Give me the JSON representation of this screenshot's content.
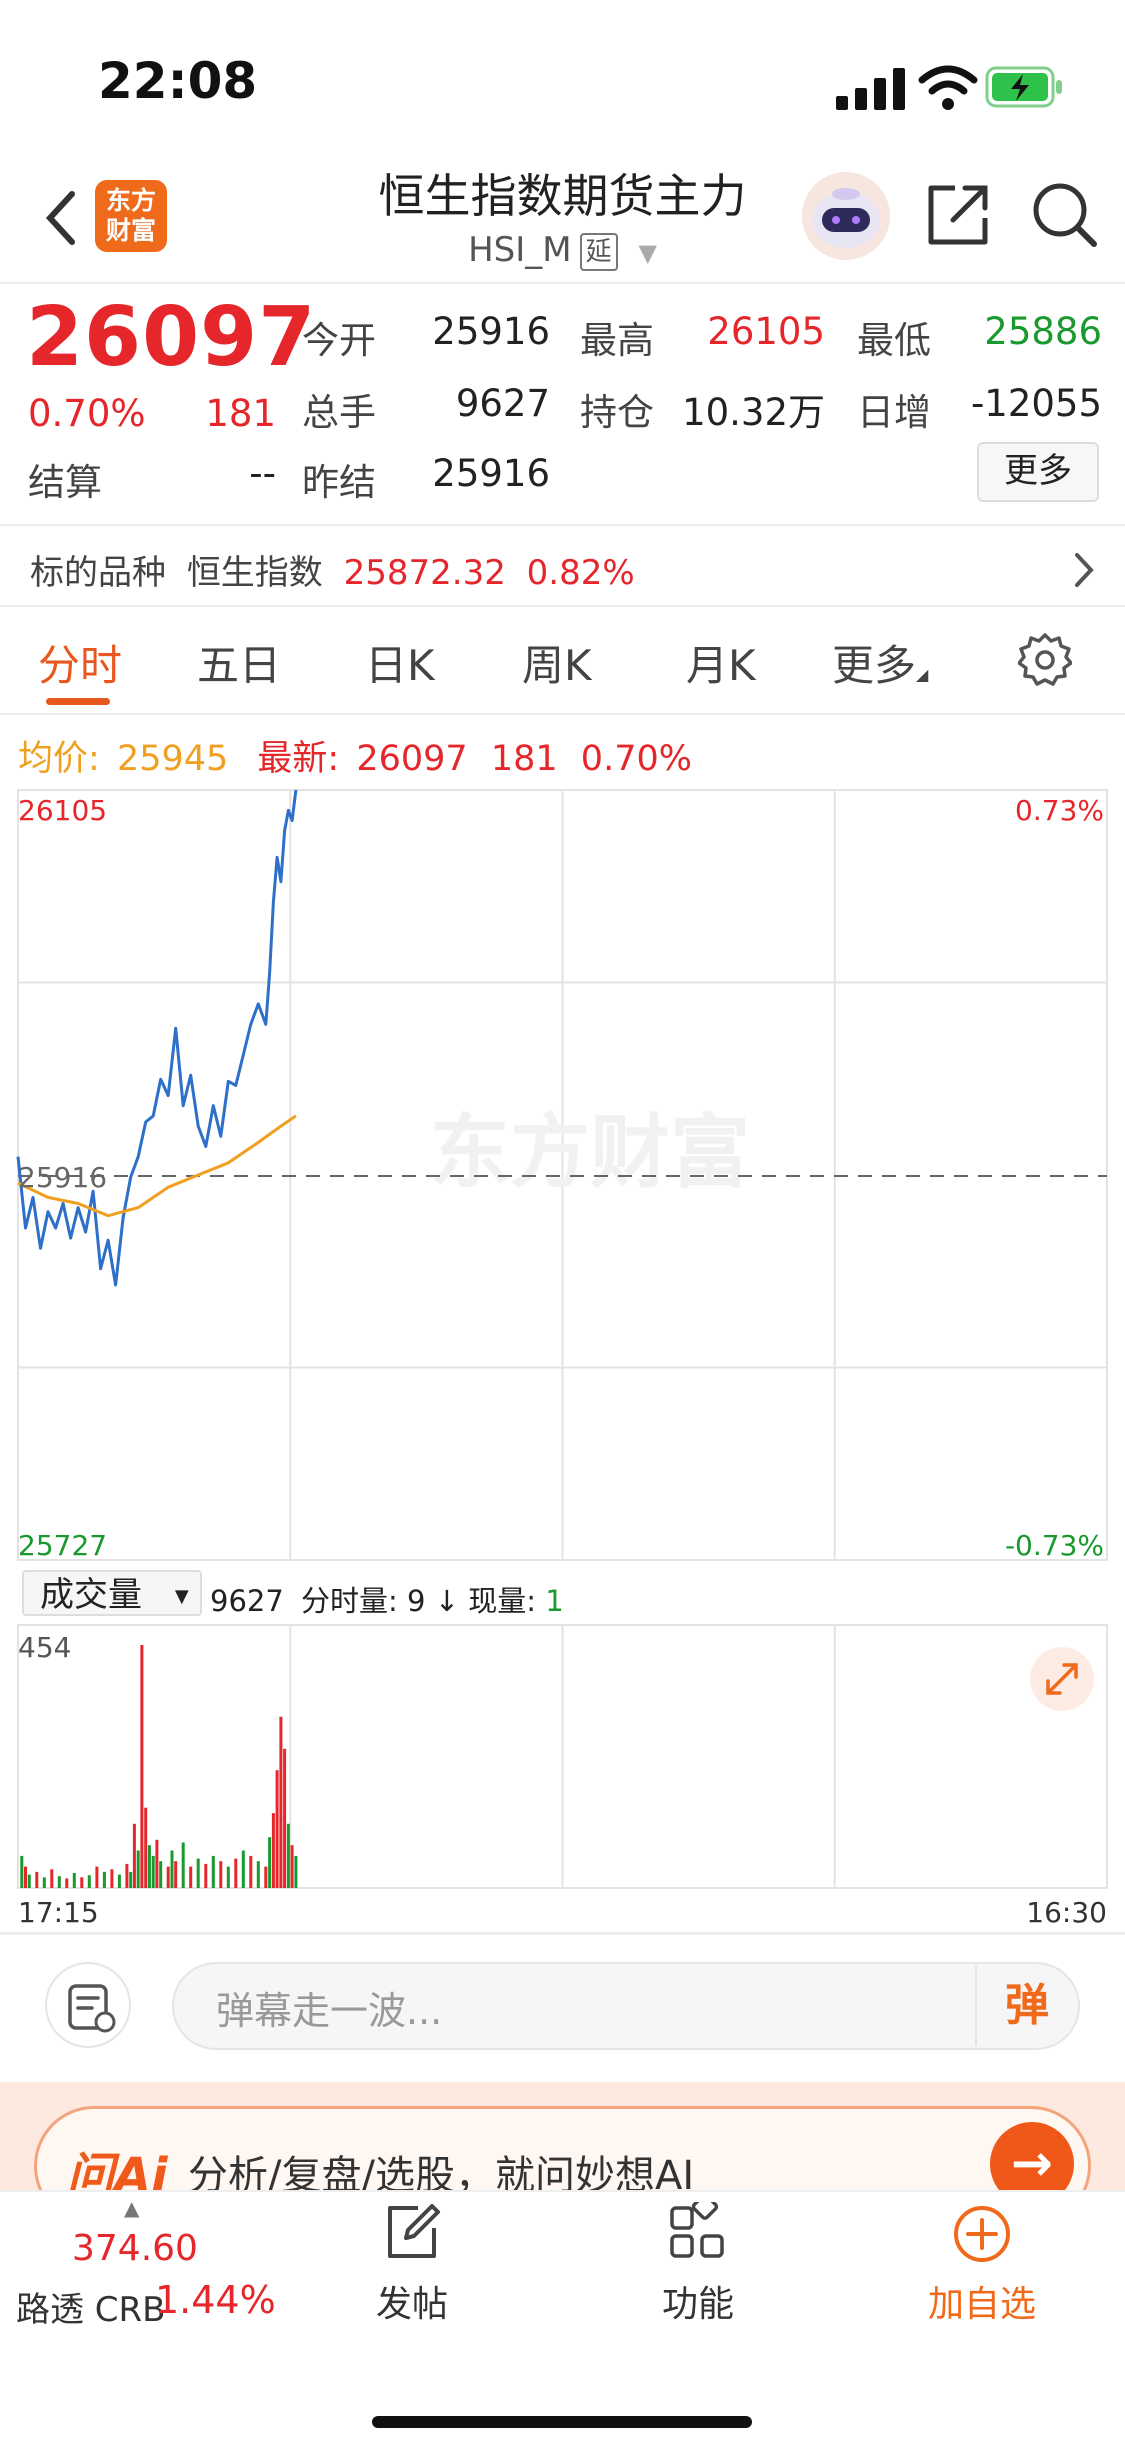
{
  "status_bar": {
    "time": "22:08"
  },
  "header": {
    "logo_text": "东方\n财富",
    "title": "恒生指数期货主力",
    "code": "HSI_M",
    "delay_tag": "延"
  },
  "quote": {
    "price": "26097",
    "change_pct": "0.70%",
    "change": "181",
    "fields": [
      {
        "label": "今开",
        "value": "25916",
        "color": "dark"
      },
      {
        "label": "最高",
        "value": "26105",
        "color": "red"
      },
      {
        "label": "最低",
        "value": "25886",
        "color": "green"
      },
      {
        "label": "总手",
        "value": "9627",
        "color": "dark"
      },
      {
        "label": "持仓",
        "value": "10.32万",
        "color": "dark"
      },
      {
        "label": "日增",
        "value": "-12055",
        "color": "dark"
      },
      {
        "label": "结算",
        "value": "--",
        "color": "dark"
      },
      {
        "label": "昨结",
        "value": "25916",
        "color": "dark"
      }
    ],
    "more_label": "更多"
  },
  "underlying": {
    "label": "标的品种",
    "name": "恒生指数",
    "price": "25872.32",
    "pct": "0.82%"
  },
  "tabs": [
    {
      "label": "分时",
      "active": true
    },
    {
      "label": "五日",
      "active": false
    },
    {
      "label": "日K",
      "active": false
    },
    {
      "label": "周K",
      "active": false
    },
    {
      "label": "月K",
      "active": false
    },
    {
      "label": "更多",
      "active": false
    }
  ],
  "info_line": {
    "avg_label": "均价:",
    "avg_value": "25945",
    "latest_label": "最新:",
    "latest_value": "26097",
    "latest_change": "181",
    "latest_pct": "0.70%"
  },
  "chart_data": {
    "type": "line",
    "y_axis_left": {
      "top": "26105",
      "mid": "25916",
      "bottom": "25727"
    },
    "y_axis_right": {
      "top": "0.73%",
      "bottom": "-0.73%"
    },
    "ylim": [
      25727,
      26105
    ],
    "reference_price": 25916,
    "x_start": "17:15",
    "x_end": "16:30",
    "watermark": "东方财富",
    "series": [
      {
        "name": "price",
        "color": "#2d6fc9",
        "x": [
          0,
          2,
          4,
          6,
          8,
          10,
          12,
          14,
          16,
          18,
          20,
          22,
          24,
          26,
          28,
          30,
          32,
          34,
          36,
          38,
          40,
          42,
          44,
          46,
          48,
          50,
          52,
          54,
          56,
          58,
          60,
          62,
          64,
          66,
          67,
          68,
          69,
          70,
          71,
          72,
          73,
          74
        ],
        "y": [
          25925,
          25890,
          25905,
          25880,
          25898,
          25890,
          25902,
          25885,
          25900,
          25888,
          25908,
          25870,
          25884,
          25862,
          25895,
          25915,
          25925,
          25942,
          25945,
          25963,
          25955,
          25988,
          25950,
          25965,
          25940,
          25930,
          25950,
          25935,
          25962,
          25960,
          25975,
          25990,
          26000,
          25990,
          26015,
          26050,
          26072,
          26060,
          26085,
          26095,
          26090,
          26105
        ]
      },
      {
        "name": "avg",
        "color": "#f0a020",
        "x": [
          0,
          8,
          16,
          24,
          32,
          40,
          48,
          56,
          64,
          70,
          74
        ],
        "y": [
          25912,
          25905,
          25902,
          25896,
          25900,
          25910,
          25916,
          25922,
          25932,
          25940,
          25945
        ]
      }
    ],
    "volume": {
      "selector_label": "成交量",
      "max_label": "454",
      "total_value": "9627",
      "minute_label": "分时量:",
      "minute_value": "9",
      "current_label": "现量:",
      "current_value": "1",
      "bars": [
        {
          "x": 1,
          "v": 60,
          "c": "green"
        },
        {
          "x": 2,
          "v": 40,
          "c": "red"
        },
        {
          "x": 3,
          "v": 25,
          "c": "green"
        },
        {
          "x": 5,
          "v": 30,
          "c": "red"
        },
        {
          "x": 7,
          "v": 20,
          "c": "green"
        },
        {
          "x": 9,
          "v": 35,
          "c": "red"
        },
        {
          "x": 11,
          "v": 22,
          "c": "green"
        },
        {
          "x": 13,
          "v": 18,
          "c": "red"
        },
        {
          "x": 15,
          "v": 28,
          "c": "green"
        },
        {
          "x": 17,
          "v": 20,
          "c": "red"
        },
        {
          "x": 19,
          "v": 24,
          "c": "green"
        },
        {
          "x": 21,
          "v": 40,
          "c": "red"
        },
        {
          "x": 23,
          "v": 30,
          "c": "green"
        },
        {
          "x": 25,
          "v": 35,
          "c": "red"
        },
        {
          "x": 27,
          "v": 25,
          "c": "green"
        },
        {
          "x": 29,
          "v": 45,
          "c": "red"
        },
        {
          "x": 30,
          "v": 30,
          "c": "green"
        },
        {
          "x": 31,
          "v": 120,
          "c": "red"
        },
        {
          "x": 32,
          "v": 70,
          "c": "green"
        },
        {
          "x": 33,
          "v": 454,
          "c": "red"
        },
        {
          "x": 34,
          "v": 150,
          "c": "red"
        },
        {
          "x": 35,
          "v": 80,
          "c": "green"
        },
        {
          "x": 36,
          "v": 60,
          "c": "green"
        },
        {
          "x": 37,
          "v": 90,
          "c": "red"
        },
        {
          "x": 38,
          "v": 50,
          "c": "green"
        },
        {
          "x": 40,
          "v": 40,
          "c": "red"
        },
        {
          "x": 41,
          "v": 70,
          "c": "green"
        },
        {
          "x": 42,
          "v": 50,
          "c": "red"
        },
        {
          "x": 44,
          "v": 85,
          "c": "green"
        },
        {
          "x": 46,
          "v": 40,
          "c": "red"
        },
        {
          "x": 48,
          "v": 55,
          "c": "green"
        },
        {
          "x": 50,
          "v": 45,
          "c": "red"
        },
        {
          "x": 52,
          "v": 60,
          "c": "green"
        },
        {
          "x": 54,
          "v": 50,
          "c": "red"
        },
        {
          "x": 56,
          "v": 40,
          "c": "green"
        },
        {
          "x": 58,
          "v": 55,
          "c": "red"
        },
        {
          "x": 60,
          "v": 70,
          "c": "green"
        },
        {
          "x": 62,
          "v": 60,
          "c": "red"
        },
        {
          "x": 64,
          "v": 50,
          "c": "green"
        },
        {
          "x": 66,
          "v": 40,
          "c": "red"
        },
        {
          "x": 67,
          "v": 95,
          "c": "green"
        },
        {
          "x": 68,
          "v": 140,
          "c": "red"
        },
        {
          "x": 69,
          "v": 220,
          "c": "red"
        },
        {
          "x": 70,
          "v": 320,
          "c": "red"
        },
        {
          "x": 71,
          "v": 260,
          "c": "red"
        },
        {
          "x": 72,
          "v": 120,
          "c": "green"
        },
        {
          "x": 73,
          "v": 80,
          "c": "red"
        },
        {
          "x": 74,
          "v": 60,
          "c": "green"
        }
      ]
    }
  },
  "comment": {
    "placeholder": "弹幕走一波...",
    "send_label": "弹"
  },
  "ai_banner": {
    "logo": "问Ai",
    "text": "分析/复盘/选股，就问妙想AI"
  },
  "bottom_nav": {
    "ticker_value": "374.60",
    "ticker_name": "路透 CRB",
    "ticker_pct": "1.44%",
    "items": [
      {
        "label": "发帖"
      },
      {
        "label": "功能"
      },
      {
        "label": "加自选"
      }
    ]
  },
  "colors": {
    "red": "#e5262a",
    "green": "#1a9a2e",
    "accent": "#e8581e",
    "price_line": "#2d6fc9",
    "avg_line": "#f0a020"
  }
}
